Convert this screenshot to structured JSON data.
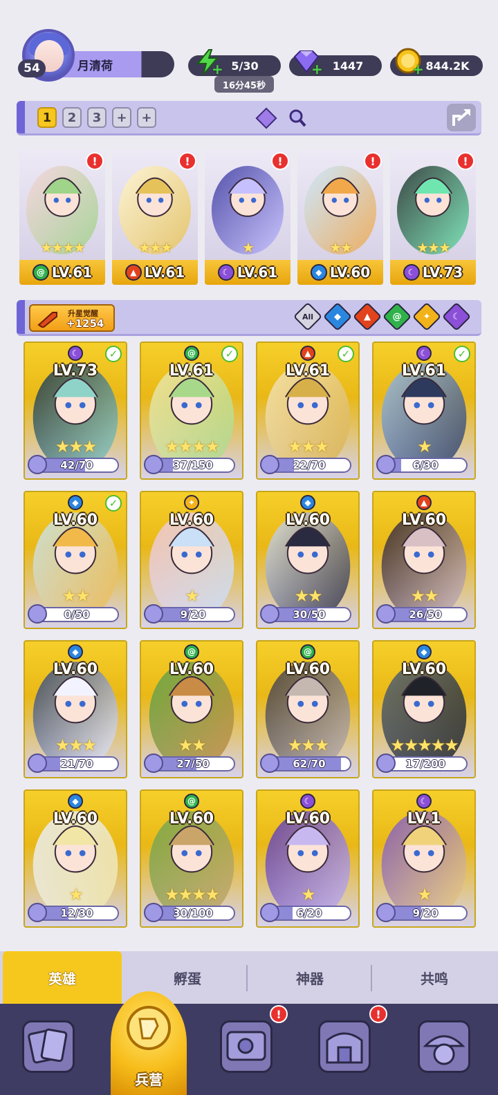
{
  "player": {
    "level": "54",
    "name": "月清荷"
  },
  "resources": {
    "energy": "5/30",
    "energy_timer": "16分45秒",
    "gems": "1447",
    "gold": "844.2K"
  },
  "team": {
    "slots": [
      "1",
      "2",
      "3",
      "+",
      "+"
    ],
    "active_slot": "1"
  },
  "lineup": [
    {
      "level": "LV.61",
      "element": "wood",
      "stars": 4
    },
    {
      "level": "LV.61",
      "element": "fire",
      "stars": 3
    },
    {
      "level": "LV.61",
      "element": "dark",
      "stars": 1
    },
    {
      "level": "LV.60",
      "element": "water",
      "stars": 2
    },
    {
      "level": "LV.73",
      "element": "dark",
      "stars": 3
    }
  ],
  "awaken": {
    "label": "升星觉醒",
    "count": "+1254"
  },
  "filter": {
    "all_label": "All",
    "elements": [
      "water",
      "fire",
      "wood",
      "light",
      "dark"
    ]
  },
  "heroes": [
    {
      "level": "LV.73",
      "element": "dark",
      "checked": true,
      "stars": 3,
      "fragments": "42/70",
      "progress": 0.6
    },
    {
      "level": "LV.61",
      "element": "wood",
      "checked": true,
      "stars": 4,
      "fragments": "37/150",
      "progress": 0.25
    },
    {
      "level": "LV.61",
      "element": "fire",
      "checked": true,
      "stars": 3,
      "fragments": "22/70",
      "progress": 0.31
    },
    {
      "level": "LV.61",
      "element": "dark",
      "checked": true,
      "stars": 1,
      "fragments": "6/30",
      "progress": 0.2
    },
    {
      "level": "LV.60",
      "element": "water",
      "checked": true,
      "stars": 2,
      "fragments": "0/50",
      "progress": 0.0
    },
    {
      "level": "LV.60",
      "element": "light",
      "checked": false,
      "stars": 1,
      "fragments": "9/20",
      "progress": 0.45
    },
    {
      "level": "LV.60",
      "element": "water",
      "checked": false,
      "stars": 2,
      "fragments": "30/50",
      "progress": 0.6
    },
    {
      "level": "LV.60",
      "element": "fire",
      "checked": false,
      "stars": 2,
      "fragments": "26/50",
      "progress": 0.52
    },
    {
      "level": "LV.60",
      "element": "water",
      "checked": false,
      "stars": 3,
      "fragments": "21/70",
      "progress": 0.3
    },
    {
      "level": "LV.60",
      "element": "wood",
      "checked": false,
      "stars": 2,
      "fragments": "27/50",
      "progress": 0.54
    },
    {
      "level": "LV.60",
      "element": "wood",
      "checked": false,
      "stars": 3,
      "fragments": "62/70",
      "progress": 0.89
    },
    {
      "level": "LV.60",
      "element": "water",
      "checked": false,
      "stars": 5,
      "fragments": "17/200",
      "progress": 0.085
    },
    {
      "level": "LV.60",
      "element": "water",
      "checked": false,
      "stars": 1,
      "fragments": "12/30",
      "progress": 0.4
    },
    {
      "level": "LV.60",
      "element": "wood",
      "checked": false,
      "stars": 4,
      "fragments": "30/100",
      "progress": 0.3
    },
    {
      "level": "LV.60",
      "element": "dark",
      "checked": false,
      "stars": 1,
      "fragments": "6/20",
      "progress": 0.3
    },
    {
      "level": "LV.1",
      "element": "dark",
      "checked": false,
      "stars": 1,
      "fragments": "9/20",
      "progress": 0.45
    }
  ],
  "tabs": [
    {
      "label": "英雄",
      "active": true
    },
    {
      "label": "孵蛋",
      "active": false
    },
    {
      "label": "神器",
      "active": false
    },
    {
      "label": "共鸣",
      "active": false
    }
  ],
  "bottom_nav": {
    "active_label": "兵营",
    "items": [
      "cards-icon",
      "barracks-icon",
      "map-icon",
      "shop-icon",
      "guild-icon"
    ]
  },
  "colors": {
    "water": "#2b86e0",
    "fire": "#e2431c",
    "wood": "#2fb24a",
    "light": "#f2b21a",
    "dark": "#8b4fd8",
    "accent": "#f6c81d"
  }
}
